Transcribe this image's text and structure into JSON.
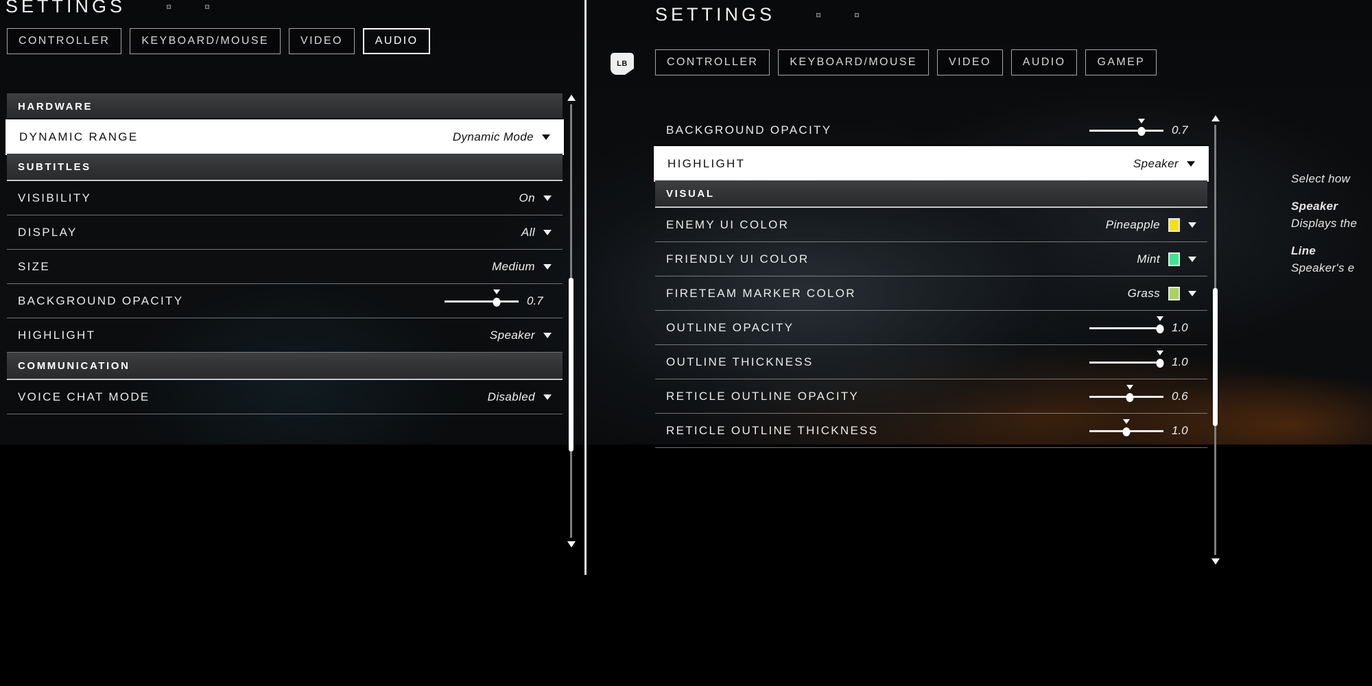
{
  "left_panel": {
    "title": "SETTINGS",
    "tabs": [
      {
        "label": "CONTROLLER",
        "selected": false
      },
      {
        "label": "KEYBOARD/MOUSE",
        "selected": false
      },
      {
        "label": "VIDEO",
        "selected": false
      },
      {
        "label": "AUDIO",
        "selected": true
      }
    ],
    "rows": [
      {
        "kind": "section",
        "label": "HARDWARE"
      },
      {
        "kind": "dropdown",
        "label": "DYNAMIC RANGE",
        "value": "Dynamic Mode",
        "selected": true
      },
      {
        "kind": "section",
        "label": "SUBTITLES"
      },
      {
        "kind": "dropdown",
        "label": "VISIBILITY",
        "value": "On"
      },
      {
        "kind": "dropdown",
        "label": "DISPLAY",
        "value": "All"
      },
      {
        "kind": "dropdown",
        "label": "SIZE",
        "value": "Medium"
      },
      {
        "kind": "slider",
        "label": "BACKGROUND OPACITY",
        "value": "0.7",
        "percent": 70
      },
      {
        "kind": "dropdown",
        "label": "HIGHLIGHT",
        "value": "Speaker"
      },
      {
        "kind": "section",
        "label": "COMMUNICATION"
      },
      {
        "kind": "dropdown",
        "label": "VOICE CHAT MODE",
        "value": "Disabled"
      }
    ],
    "scrollbar": {
      "thumb_top_pct": 40,
      "thumb_height_pct": 40
    }
  },
  "right_panel": {
    "title": "SETTINGS",
    "bumper_left": "LB",
    "tabs": [
      {
        "label": "CONTROLLER",
        "selected": false
      },
      {
        "label": "KEYBOARD/MOUSE",
        "selected": false
      },
      {
        "label": "VIDEO",
        "selected": false
      },
      {
        "label": "AUDIO",
        "selected": false
      },
      {
        "label": "GAMEP",
        "selected": false
      }
    ],
    "rows": [
      {
        "kind": "slider",
        "label": "BACKGROUND OPACITY",
        "value": "0.7",
        "percent": 70
      },
      {
        "kind": "dropdown",
        "label": "HIGHLIGHT",
        "value": "Speaker",
        "selected": true
      },
      {
        "kind": "section",
        "label": "VISUAL"
      },
      {
        "kind": "color",
        "label": "ENEMY UI COLOR",
        "value": "Pineapple",
        "color": "#F5E010"
      },
      {
        "kind": "color",
        "label": "FRIENDLY UI COLOR",
        "value": "Mint",
        "color": "#3CE88B"
      },
      {
        "kind": "color",
        "label": "FIRETEAM MARKER COLOR",
        "value": "Grass",
        "color": "#A9D35C"
      },
      {
        "kind": "slider",
        "label": "OUTLINE OPACITY",
        "value": "1.0",
        "percent": 95
      },
      {
        "kind": "slider",
        "label": "OUTLINE THICKNESS",
        "value": "1.0",
        "percent": 95
      },
      {
        "kind": "slider",
        "label": "RETICLE OUTLINE OPACITY",
        "value": "0.6",
        "percent": 55
      },
      {
        "kind": "slider",
        "label": "RETICLE OUTLINE THICKNESS",
        "value": "1.0",
        "percent": 50
      }
    ],
    "scrollbar": {
      "thumb_top_pct": 38,
      "thumb_height_pct": 32
    }
  },
  "description": {
    "lines": [
      {
        "text": "Select how",
        "strong": false
      },
      {
        "text": "Speaker",
        "strong": true
      },
      {
        "text": "Displays the",
        "strong": false
      },
      {
        "text": "Line",
        "strong": true
      },
      {
        "text": "Speaker's e",
        "strong": false
      }
    ]
  }
}
